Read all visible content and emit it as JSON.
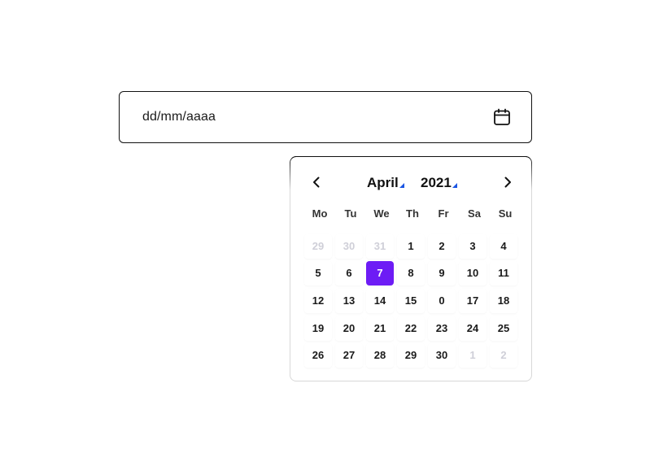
{
  "date_input": {
    "placeholder": "dd/mm/aaaa",
    "icon": "calendar-icon"
  },
  "calendar": {
    "month": "April",
    "year": "2021",
    "prev_icon": "chevron-left-icon",
    "next_icon": "chevron-right-icon",
    "weekdays": [
      "Mo",
      "Tu",
      "We",
      "Th",
      "Fr",
      "Sa",
      "Su"
    ],
    "weeks": [
      [
        {
          "d": "29",
          "muted": true
        },
        {
          "d": "30",
          "muted": true
        },
        {
          "d": "31",
          "muted": true
        },
        {
          "d": "1"
        },
        {
          "d": "2"
        },
        {
          "d": "3"
        },
        {
          "d": "4"
        }
      ],
      [
        {
          "d": "5"
        },
        {
          "d": "6"
        },
        {
          "d": "7",
          "selected": true
        },
        {
          "d": "8"
        },
        {
          "d": "9"
        },
        {
          "d": "10"
        },
        {
          "d": "11"
        }
      ],
      [
        {
          "d": "12"
        },
        {
          "d": "13"
        },
        {
          "d": "14"
        },
        {
          "d": "15"
        },
        {
          "d": "0"
        },
        {
          "d": "17"
        },
        {
          "d": "18"
        }
      ],
      [
        {
          "d": "19"
        },
        {
          "d": "20"
        },
        {
          "d": "21"
        },
        {
          "d": "22"
        },
        {
          "d": "23"
        },
        {
          "d": "24"
        },
        {
          "d": "25"
        }
      ],
      [
        {
          "d": "26"
        },
        {
          "d": "27"
        },
        {
          "d": "28"
        },
        {
          "d": "29"
        },
        {
          "d": "30"
        },
        {
          "d": "1",
          "muted": true
        },
        {
          "d": "2",
          "muted": true
        }
      ]
    ],
    "colors": {
      "selected_bg": "#6d1cf5",
      "dropdown_indicator": "#1a55e3",
      "muted_text": "#cfcfd8"
    }
  }
}
